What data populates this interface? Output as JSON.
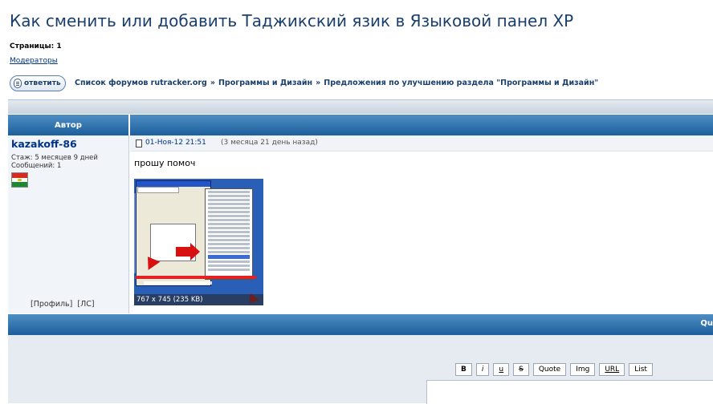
{
  "topic": {
    "title": "Как сменить или добавить Таджикский язик в Языковой панел XP",
    "pages": "Страницы: 1",
    "moderators": "Модераторы"
  },
  "nav": {
    "reply_label": "ответить",
    "breadcrumb": [
      "Список форумов rutracker.org",
      "Программы и Дизайн",
      "Предложения по улучшению раздела \"Программы и Дизайн\""
    ],
    "separator": "»"
  },
  "table": {
    "author_header": "Автор"
  },
  "post": {
    "author": "kazakoff-86",
    "stazh": "Стаж: 5 месяцев 9 дней",
    "messages": "Сообщений: 1",
    "profile_link": "[Профиль]",
    "pm_link": "[ЛС]",
    "date": "01-Ноя-12 21:51",
    "ago": "(3 месяца 21 день назад)",
    "text": "прошу помоч",
    "attachment_info": "767 x 745 (235 KB)"
  },
  "quick_reply": {
    "label": "Qu",
    "buttons": [
      "B",
      "i",
      "u",
      "S",
      "Quote",
      "Img",
      "URL",
      "List"
    ]
  },
  "colors": {
    "header_blue": "#1c5f9c",
    "link_blue": "#00338a",
    "title_blue": "#1a3f6d"
  }
}
